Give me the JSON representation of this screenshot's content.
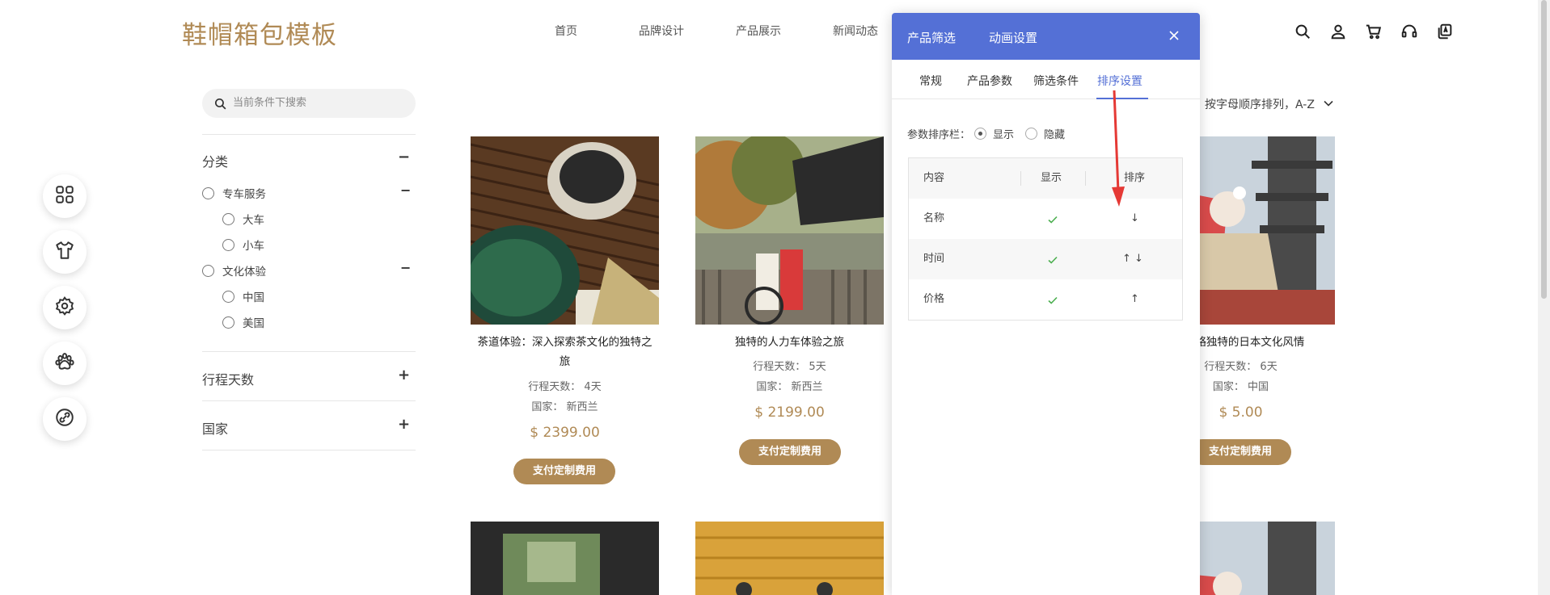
{
  "header": {
    "logo": "鞋帽箱包模板",
    "nav": [
      "首页",
      "品牌设计",
      "产品展示",
      "新闻动态"
    ],
    "icons": [
      "search-icon",
      "user-icon",
      "cart-icon",
      "headset-icon",
      "copy-icon"
    ]
  },
  "floating_menu": [
    "grid-icon",
    "shirt-icon",
    "gear-icon",
    "paw-icon",
    "link-icon"
  ],
  "filter": {
    "search_placeholder": "当前条件下搜索",
    "sections": [
      {
        "title": "分类",
        "sign": "−"
      },
      {
        "title": "行程天数",
        "sign": "+"
      },
      {
        "title": "国家",
        "sign": "+"
      }
    ],
    "options": [
      {
        "label": "专车服务",
        "sign": "−"
      },
      {
        "label": "大车"
      },
      {
        "label": "小车"
      },
      {
        "label": "文化体验",
        "sign": "−"
      },
      {
        "label": "中国"
      },
      {
        "label": "美国"
      }
    ]
  },
  "sort": {
    "label": "按字母顺序排列，A-Z"
  },
  "products": [
    {
      "title_line1": "茶道体验：深入探索茶文化的独特之",
      "title_line2": "旅",
      "days": "行程天数： 4天",
      "country": "国家： 新西兰",
      "price": "$ 2399.00",
      "button": "支付定制费用"
    },
    {
      "title_line1": "独特的人力车体验之旅",
      "days": "行程天数： 5天",
      "country": "国家： 新西兰",
      "price": "$ 2199.00",
      "button": "支付定制费用"
    },
    {
      "title_line1": "- 领略独特的日本文化风情",
      "days": "行程天数： 6天",
      "country": "国家： 中国",
      "price": "$ 5.00",
      "button": "支付定制费用"
    }
  ],
  "panel": {
    "head_tabs": [
      "产品筛选",
      "动画设置"
    ],
    "sub_tabs": [
      "常规",
      "产品参数",
      "筛选条件",
      "排序设置"
    ],
    "active_sub_tab": "排序设置",
    "param_sort_label": "参数排序栏：",
    "radio_show": "显示",
    "radio_hide": "隐藏",
    "selected_radio": "显示",
    "table": {
      "headers": [
        "内容",
        "显示",
        "排序"
      ],
      "rows": [
        {
          "name": "名称",
          "show": true,
          "sort": "↓"
        },
        {
          "name": "时间",
          "show": true,
          "sort": "↑ ↓"
        },
        {
          "name": "价格",
          "show": true,
          "sort": "↑"
        }
      ]
    }
  },
  "colors": {
    "brand": "#b08a55",
    "panel_accent": "#5470d6",
    "annotation": "#e53935",
    "check": "#4caf50"
  }
}
